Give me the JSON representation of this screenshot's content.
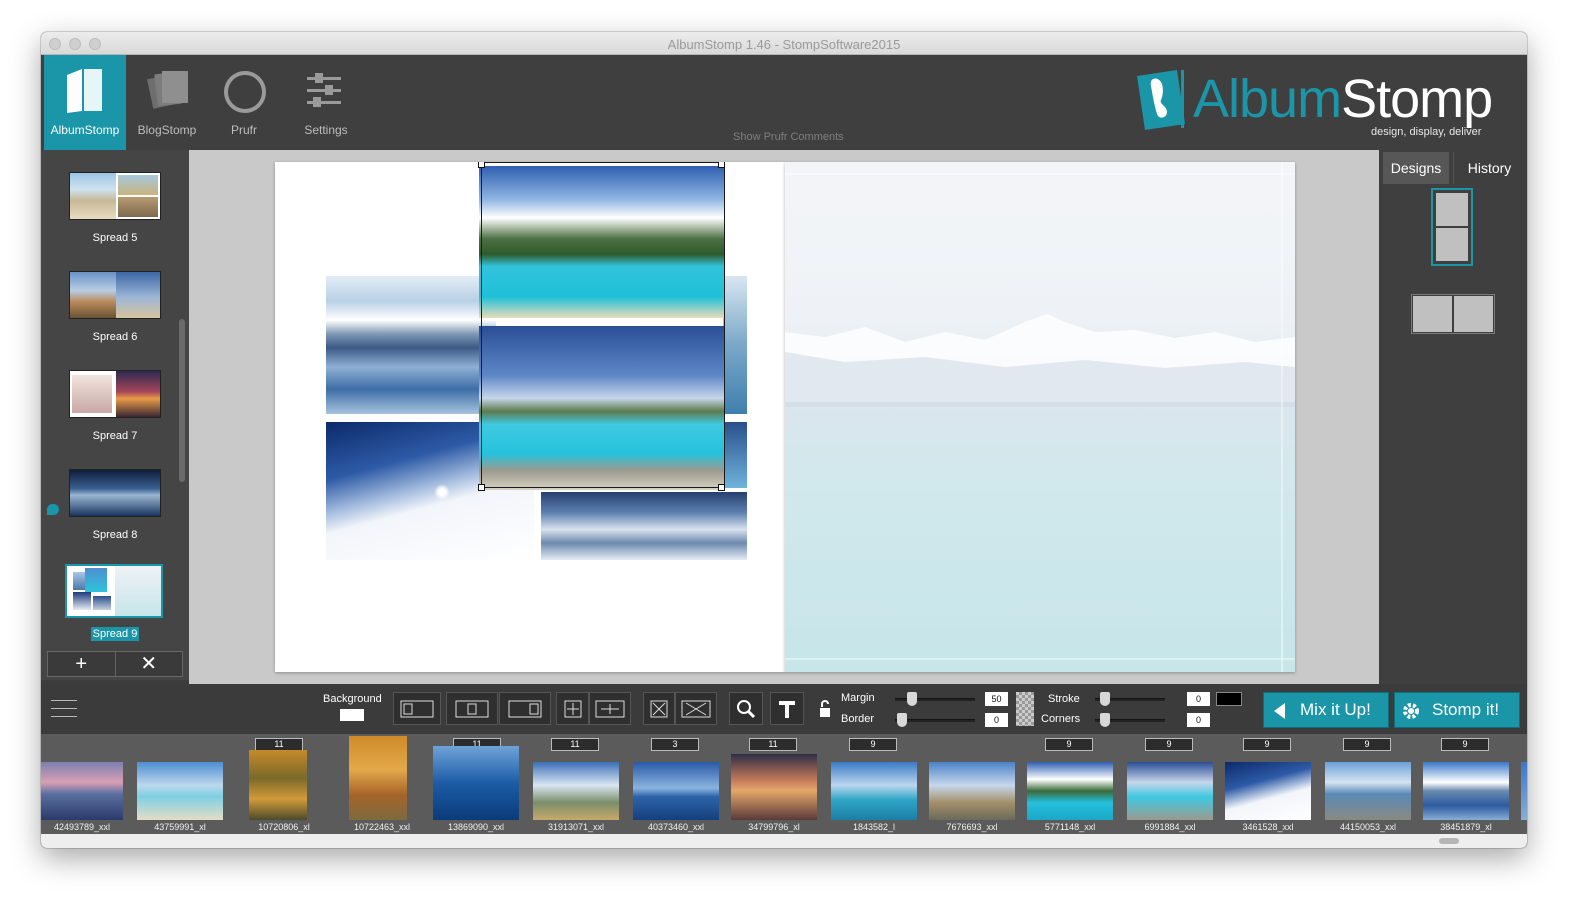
{
  "window": {
    "title": "AlbumStomp 1.46 - StompSoftware2015"
  },
  "topnav": [
    {
      "label": "AlbumStomp",
      "icon": "book-icon",
      "active": true
    },
    {
      "label": "BlogStomp",
      "icon": "cards-icon",
      "active": false
    },
    {
      "label": "Prufr",
      "icon": "circle-icon",
      "active": false
    },
    {
      "label": "Settings",
      "icon": "sliders-icon",
      "active": false
    }
  ],
  "show_prufr_comments": "Show Prufr Comments",
  "brand": {
    "name_a": "Album",
    "name_b": "Stomp",
    "tagline": "design, display, deliver"
  },
  "sidebar": {
    "spreads": [
      {
        "label": "Spread 5"
      },
      {
        "label": "Spread 6"
      },
      {
        "label": "Spread 7"
      },
      {
        "label": "Spread 8"
      },
      {
        "label": "Spread 9",
        "selected": true
      }
    ],
    "add_label": "+",
    "remove_label": "✕"
  },
  "right_panel": {
    "tabs": [
      {
        "label": "Designs",
        "active": true
      },
      {
        "label": "History",
        "active": false
      }
    ]
  },
  "toolbar": {
    "background_label": "Background",
    "margin_label": "Margin",
    "margin_value": "50",
    "border_label": "Border",
    "border_value": "0",
    "stroke_label": "Stroke",
    "stroke_value": "0",
    "corners_label": "Corners",
    "corners_value": "0",
    "mix_label": "Mix it Up!",
    "stomp_label": "Stomp it!"
  },
  "tray": [
    {
      "name": "42493789_xxl",
      "count": ""
    },
    {
      "name": "43759991_xl",
      "count": ""
    },
    {
      "name": "10720806_xl",
      "count": "11"
    },
    {
      "name": "10722463_xxl",
      "count": ""
    },
    {
      "name": "13869090_xxl",
      "count": "11"
    },
    {
      "name": "31913071_xxl",
      "count": "11"
    },
    {
      "name": "40373460_xxl",
      "count": "3"
    },
    {
      "name": "34799796_xl",
      "count": "11"
    },
    {
      "name": "1843582_l",
      "count": "9"
    },
    {
      "name": "7676693_xxl",
      "count": ""
    },
    {
      "name": "5771148_xxl",
      "count": "9"
    },
    {
      "name": "6991884_xxl",
      "count": "9"
    },
    {
      "name": "3461528_xxl",
      "count": "9"
    },
    {
      "name": "44150053_xxl",
      "count": "9"
    },
    {
      "name": "38451879_xl",
      "count": "9"
    }
  ],
  "colors": {
    "accent": "#1b95a8",
    "panel": "#3f3f3f",
    "canvas": "#c9c9c9"
  }
}
